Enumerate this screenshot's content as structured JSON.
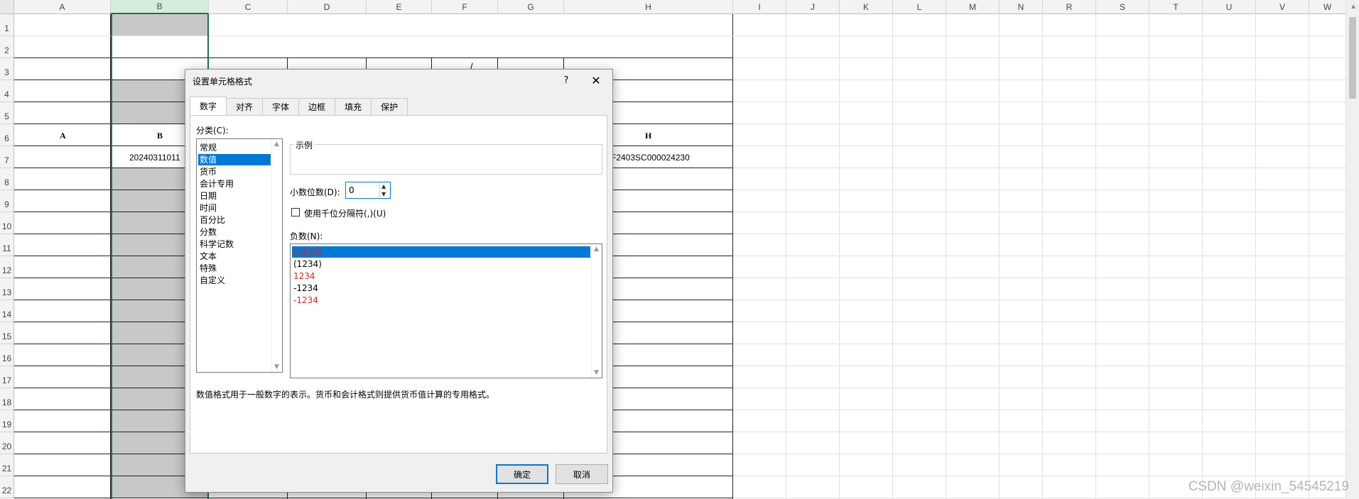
{
  "sheet": {
    "columns": [
      "A",
      "B",
      "C",
      "D",
      "E",
      "F",
      "G",
      "H",
      "I",
      "J",
      "K",
      "L",
      "M",
      "N",
      "R",
      "S",
      "T",
      "U",
      "V",
      "W"
    ],
    "rows": [
      "1",
      "2",
      "3",
      "4",
      "5",
      "6",
      "7",
      "8",
      "9",
      "10",
      "11",
      "12",
      "13",
      "14",
      "15",
      "16",
      "17",
      "18",
      "19",
      "20",
      "21",
      "22"
    ],
    "row6_headers": {
      "A": "A",
      "B": "B",
      "H": "H"
    },
    "row7_b": "20240311011",
    "row7_h": "F2403SC000024230",
    "row3_mark": "/"
  },
  "dialog": {
    "title": "设置单元格格式",
    "help": "?",
    "close": "✕",
    "tabs": [
      "数字",
      "对齐",
      "字体",
      "边框",
      "填充",
      "保护"
    ],
    "category_label": "分类(C):",
    "categories": [
      "常规",
      "数值",
      "货币",
      "会计专用",
      "日期",
      "时间",
      "百分比",
      "分数",
      "科学记数",
      "文本",
      "特殊",
      "自定义"
    ],
    "selected_category": "数值",
    "sample_label": "示例",
    "decimal_label": "小数位数(D):",
    "decimal_value": "0",
    "thousands_label": "使用千位分隔符(,)(U)",
    "negative_label": "负数(N):",
    "negatives": [
      {
        "text": "(1234)",
        "red": true,
        "selected": true
      },
      {
        "text": "(1234)",
        "red": false,
        "selected": false
      },
      {
        "text": "1234",
        "red": true,
        "selected": false
      },
      {
        "text": "-1234",
        "red": false,
        "selected": false
      },
      {
        "text": "-1234",
        "red": true,
        "selected": false
      }
    ],
    "description": "数值格式用于一般数字的表示。货币和会计格式则提供货币值计算的专用格式。",
    "ok": "确定",
    "cancel": "取消"
  },
  "watermark": "CSDN @weixin_54545219",
  "colors": {
    "accent": "#217346",
    "selection": "#0078d7",
    "red": "#e02020"
  }
}
